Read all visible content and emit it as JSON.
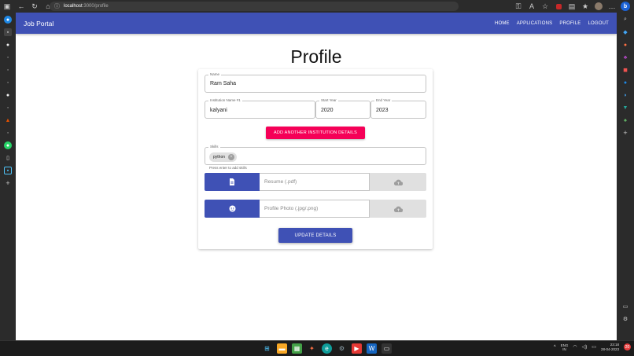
{
  "browser": {
    "url_host": "localhost",
    "url_path": ":3000/profile"
  },
  "appbar": {
    "title": "Job Portal",
    "nav": [
      "HOME",
      "APPLICATIONS",
      "PROFILE",
      "LOGOUT"
    ]
  },
  "page": {
    "title": "Profile"
  },
  "form": {
    "name": {
      "label": "Name",
      "value": "Ram Saha"
    },
    "institution": {
      "label": "Institution Name #1",
      "value": "kalyani"
    },
    "start_year": {
      "label": "Start Year",
      "value": "2020"
    },
    "end_year": {
      "label": "End Year",
      "value": "2023"
    },
    "add_institution_label": "ADD ANOTHER INSTITUTION DETAILS",
    "skills": {
      "label": "Skills",
      "chips": [
        "python"
      ],
      "helper": "Press enter to add skills"
    },
    "resume": {
      "placeholder": "Resume (.pdf)"
    },
    "photo": {
      "placeholder": "Profile Photo (.jpg/.png)"
    },
    "update_label": "UPDATE DETAILS"
  },
  "taskbar": {
    "lang_top": "ENG",
    "lang_bottom": "IN",
    "time": "23:18",
    "date": "28-04-2023",
    "notifications": "20"
  },
  "colors": {
    "primary": "#3f51b5",
    "secondary": "#f50057"
  }
}
